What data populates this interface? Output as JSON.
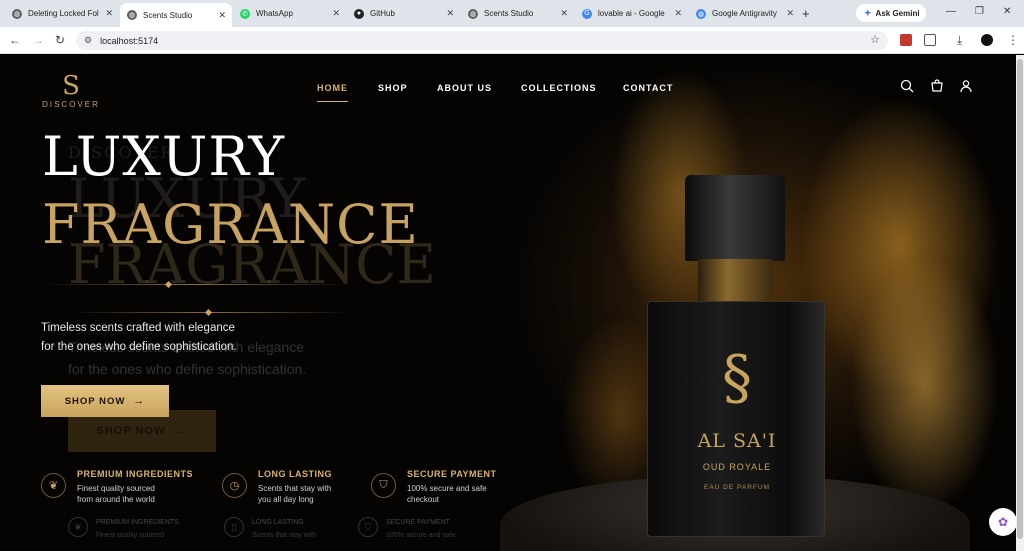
{
  "browser": {
    "tabs": [
      {
        "label": "Deleting Locked Fol",
        "color": "#5f6368",
        "active": false
      },
      {
        "label": "Scents Studio",
        "color": "#5f6368",
        "active": true
      },
      {
        "label": "WhatsApp",
        "color": "#25d366",
        "active": false
      },
      {
        "label": "GitHub",
        "color": "#1f2328",
        "active": false
      },
      {
        "label": "Scents Studio",
        "color": "#5f6368",
        "active": false
      },
      {
        "label": "lovable ai - Google",
        "color": "#4285f4",
        "active": false
      },
      {
        "label": "Google Antigravity",
        "color": "#4285f4",
        "active": false
      }
    ],
    "new_tab": "+",
    "ask_gemini": "Ask Gemini",
    "url": "localhost:5174"
  },
  "site": {
    "logo_mark": "S",
    "logo_word": "DISCOVER",
    "nav": [
      "HOME",
      "SHOP",
      "ABOUT US",
      "COLLECTIONS",
      "CONTACT"
    ],
    "active_nav": "HOME",
    "hero": {
      "line1": "LUXURY",
      "line2": "FRAGRANCE",
      "tagline1": "Timeless scents crafted with elegance",
      "tagline2": "for the ones who define sophistication.",
      "cta": "SHOP NOW"
    },
    "features": [
      {
        "icon": "leaf-icon",
        "title": "PREMIUM INGREDIENTS",
        "line1": "Finest quality sourced",
        "line2": "from around the world"
      },
      {
        "icon": "clock-icon",
        "title": "LONG LASTING",
        "line1": "Scents that stay with",
        "line2": "you all day long"
      },
      {
        "icon": "shield-icon",
        "title": "SECURE PAYMENT",
        "line1": "100% secure and safe",
        "line2": "checkout"
      }
    ],
    "product": {
      "brand": "AL SA'I",
      "name": "OUD ROYALE",
      "type": "EAU DE PARFUM"
    }
  },
  "colors": {
    "gold": "#c9a45c",
    "accent": "#d9b36a"
  }
}
